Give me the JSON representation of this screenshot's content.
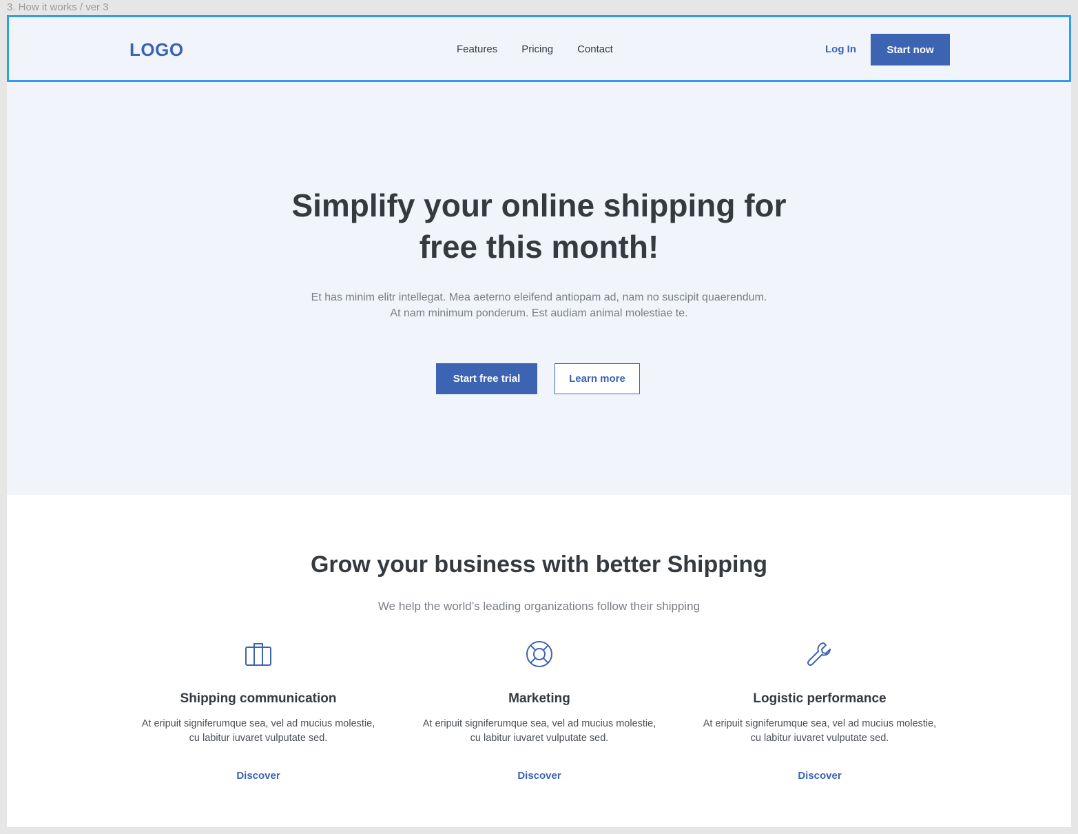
{
  "frame_label": "3. How it works / ver 3",
  "colors": {
    "brand": "#3d63b3",
    "hero_bg": "#f1f5fb",
    "selection_outline": "#2e9cf0",
    "heading": "#343a3f",
    "muted": "#7a7f85"
  },
  "nav": {
    "logo": "LOGO",
    "links": [
      "Features",
      "Pricing",
      "Contact"
    ],
    "login": "Log In",
    "cta": "Start now"
  },
  "hero": {
    "title_line1": "Simplify your online shipping for",
    "title_line2": "free this month!",
    "sub_line1": "Et has minim elitr intellegat. Mea aeterno eleifend antiopam ad, nam no suscipit quaerendum.",
    "sub_line2": "At nam minimum ponderum. Est audiam animal molestiae te.",
    "primary_button": "Start free trial",
    "secondary_button": "Learn more"
  },
  "features_section": {
    "title": "Grow your business with better Shipping",
    "subtitle": "We help the world’s leading organizations follow their shipping",
    "items": [
      {
        "icon": "briefcase-icon",
        "title": "Shipping communication",
        "desc_line1": "At eripuit signiferumque sea, vel ad mucius molestie,",
        "desc_line2": "cu labitur iuvaret vulputate sed.",
        "link": "Discover"
      },
      {
        "icon": "lifebuoy-icon",
        "title": "Marketing",
        "desc_line1": "At eripuit signiferumque sea, vel ad mucius molestie,",
        "desc_line2": "cu labitur iuvaret vulputate sed.",
        "link": "Discover"
      },
      {
        "icon": "wrench-icon",
        "title": "Logistic performance",
        "desc_line1": "At eripuit signiferumque sea, vel ad mucius molestie,",
        "desc_line2": "cu labitur iuvaret vulputate sed.",
        "link": "Discover"
      }
    ]
  }
}
